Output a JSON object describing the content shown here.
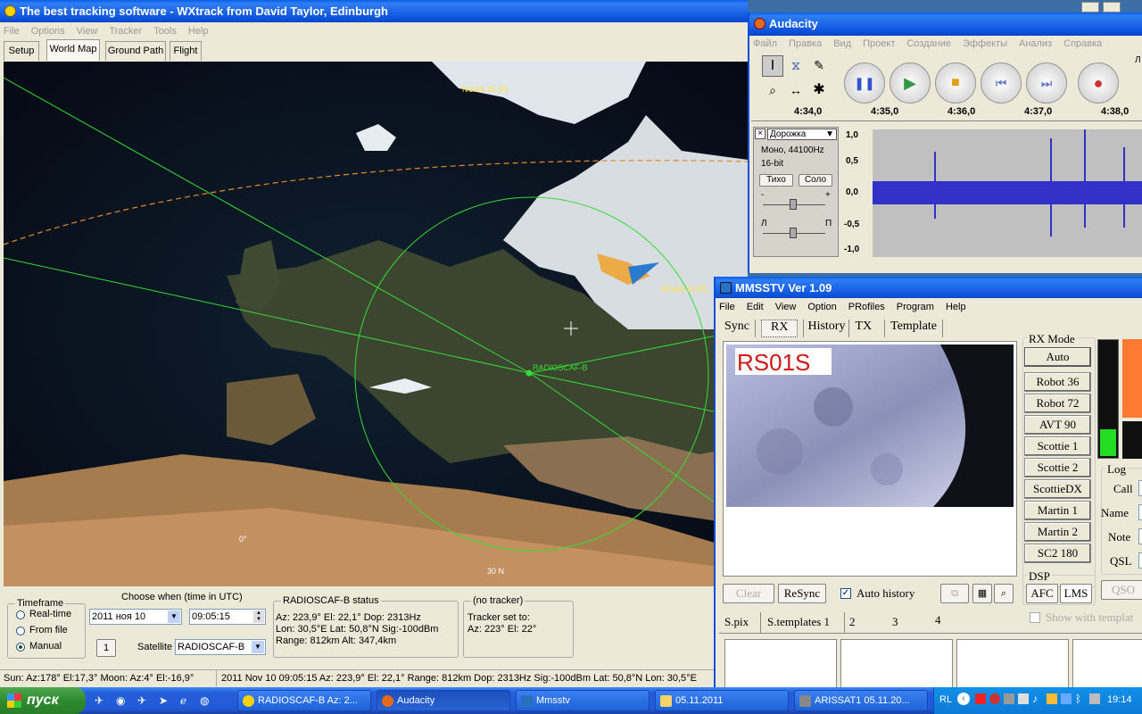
{
  "wxtrack": {
    "title": "The best tracking software - WXtrack from David Taylor, Edinburgh",
    "menu": [
      "File",
      "Options",
      "View",
      "Tracker",
      "Tools",
      "Help"
    ],
    "tabs": [
      "Setup",
      "World Map",
      "Ground Path",
      "Flight"
    ],
    "map_labels": {
      "noaa15": "NOAA 15 [P]",
      "noaa19": "NOAA 19 [P]",
      "radioscaf": "RADIOSCAF-B",
      "lon0": "0°",
      "lat30": "30 N"
    },
    "timeframe": {
      "legend": "Timeframe",
      "options": [
        "Real-time",
        "From file",
        "Manual"
      ],
      "selected": "Manual"
    },
    "choose_when_label": "Choose when (time in UTC)",
    "date_value": "2011 ноя 10",
    "time_value": "09:05:15",
    "one_button": "1",
    "satellite_label": "Satellite",
    "satellite_value": "RADIOSCAF-B",
    "status": {
      "legend": "RADIOSCAF-B status",
      "line1": "Az: 223,9°  El: 22,1°  Dop: 2313Hz",
      "line2": "Lon: 30,5°E  Lat: 50,8°N  Sig:-100dBm",
      "line3": "Range: 812km  Alt: 347,4km"
    },
    "tracker": {
      "legend": "(no tracker)",
      "line1": "Tracker set to:",
      "line2": "Az: 223°  El: 22°"
    },
    "statusbar": {
      "left": "Sun: Az:178° El:17,3°  Moon: Az:4° El:-16,9°",
      "right": "2011 Nov 10  09:05:15  Az: 223,9°  El: 22,1°  Range: 812km  Dop: 2313Hz  Sig:-100dBm  Lat: 50,8°N  Lon: 30,5°E"
    }
  },
  "audacity": {
    "title": "Audacity",
    "menu": [
      "Файл",
      "Правка",
      "Вид",
      "Проект",
      "Создание",
      "Эффекты",
      "Анализ",
      "Справка"
    ],
    "timeline": [
      "4:34,0",
      "4:35,0",
      "4:36,0",
      "4:37,0",
      "4:38,0"
    ],
    "track_name": "Дорожка",
    "track_info1": "Моно, 44100Hz",
    "track_info2": "16-bit",
    "mute": "Тихо",
    "solo": "Соло",
    "gain_left": "-",
    "gain_right": "+",
    "pan_left": "Л",
    "pan_right": "П",
    "scale": [
      "1,0",
      "0,5",
      "0,0",
      "-0,5",
      "-1,0"
    ],
    "meter_label": "Л"
  },
  "mmsstv": {
    "title": "MMSSTV Ver 1.09",
    "menu": [
      "File",
      "Edit",
      "View",
      "Option",
      "PRofiles",
      "Program",
      "Help"
    ],
    "tabs": [
      "Sync",
      "RX",
      "History",
      "TX",
      "Template"
    ],
    "image_text": "RS01S",
    "rx_mode_legend": "RX Mode",
    "auto": "Auto",
    "modes": [
      "Robot 36",
      "Robot 72",
      "AVT 90",
      "Scottie 1",
      "Scottie 2",
      "ScottieDX",
      "Martin 1",
      "Martin 2",
      "SC2 180"
    ],
    "clear": "Clear",
    "resync": "ReSync",
    "auto_history": "Auto history",
    "dsp_legend": "DSP",
    "afc": "AFC",
    "lms": "LMS",
    "log_legend": "Log",
    "log_fields": [
      "Call",
      "Name",
      "Note",
      "QSL"
    ],
    "qso": "QSO",
    "bottom_tabs": [
      "S.pix",
      "S.templates 1",
      "2",
      "3",
      "4"
    ],
    "show_templates": "Show with templat"
  },
  "taskbar": {
    "start": "пуск",
    "buttons": [
      "RADIOSCAF-B  Az: 2...",
      "Audacity",
      "Mmsstv",
      "05.11.2011",
      "ARISSAT1 05.11.20..."
    ],
    "lang": "RL",
    "clock": "19:14"
  },
  "colors": {
    "xp_blue": "#0b4fd8",
    "track_green": "#33dd33",
    "orbit_orange": "#e8882a",
    "label_yellow": "#ffe23a",
    "waveform": "#3232c8"
  }
}
